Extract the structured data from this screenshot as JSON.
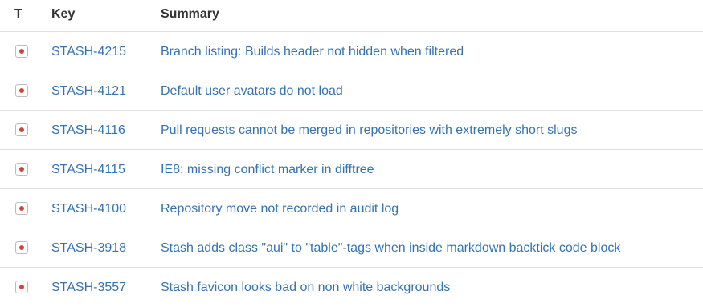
{
  "header": {
    "type_label": "T",
    "key_label": "Key",
    "summary_label": "Summary"
  },
  "colors": {
    "link": "#3572b0",
    "bug_icon": "#d04437",
    "text": "#333333",
    "divider": "#e0e0e0"
  },
  "issues": [
    {
      "type_icon": "bug-icon",
      "key": "STASH-4215",
      "summary": "Branch listing: Builds header not hidden when filtered"
    },
    {
      "type_icon": "bug-icon",
      "key": "STASH-4121",
      "summary": "Default user avatars do not load"
    },
    {
      "type_icon": "bug-icon",
      "key": "STASH-4116",
      "summary": "Pull requests cannot be merged in repositories with extremely short slugs"
    },
    {
      "type_icon": "bug-icon",
      "key": "STASH-4115",
      "summary": "IE8: missing conflict marker in difftree"
    },
    {
      "type_icon": "bug-icon",
      "key": "STASH-4100",
      "summary": "Repository move not recorded in audit log"
    },
    {
      "type_icon": "bug-icon",
      "key": "STASH-3918",
      "summary": "Stash adds class \"aui\" to \"table\"-tags when inside markdown backtick code block"
    },
    {
      "type_icon": "bug-icon",
      "key": "STASH-3557",
      "summary": "Stash favicon looks bad on non white backgrounds"
    }
  ]
}
